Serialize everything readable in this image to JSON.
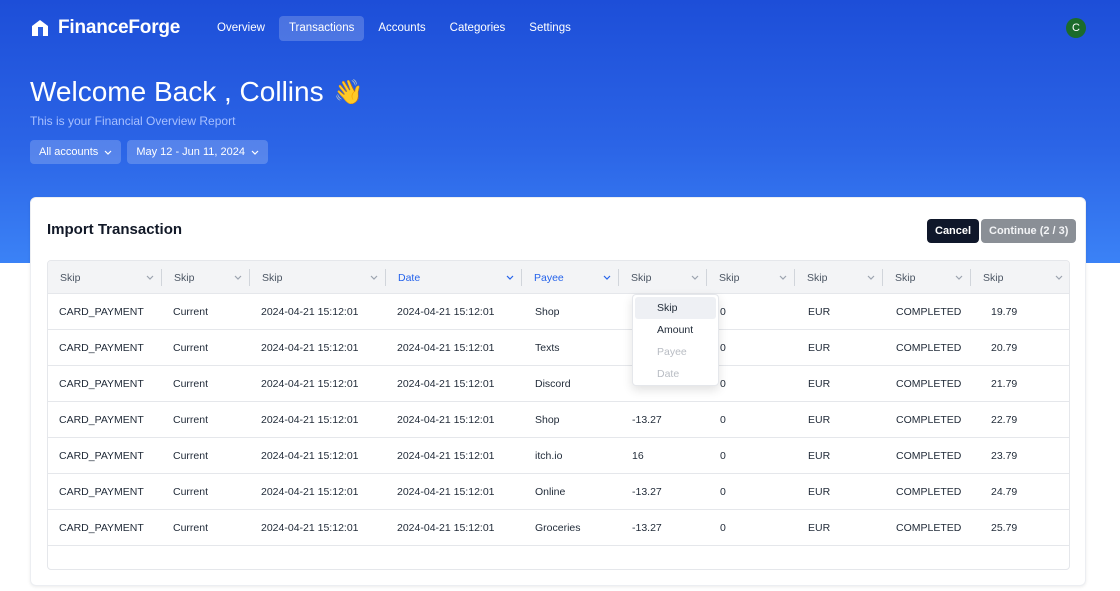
{
  "app": {
    "name": "FinanceForge"
  },
  "nav": {
    "links": [
      {
        "label": "Overview"
      },
      {
        "label": "Transactions"
      },
      {
        "label": "Accounts"
      },
      {
        "label": "Categories"
      },
      {
        "label": "Settings"
      }
    ],
    "active": "Transactions",
    "avatar_initial": "C"
  },
  "hero": {
    "welcome": "Welcome Back , Collins",
    "wave": "👋",
    "subtitle": "This is your Financial Overview Report",
    "account_filter": "All accounts",
    "date_filter": "May 12 - Jun 11, 2024"
  },
  "import": {
    "title": "Import Transaction",
    "cancel_label": "Cancel",
    "continue_label": "Continue (2 / 3)",
    "headers": [
      "Skip",
      "Skip",
      "Skip",
      "Date",
      "Payee",
      "Skip",
      "Skip",
      "Skip",
      "Skip",
      "Skip"
    ],
    "rows": [
      [
        "CARD_PAYMENT",
        "Current",
        "2024-04-21 15:12:01",
        "2024-04-21 15:12:01",
        "Shop",
        "",
        "0",
        "EUR",
        "COMPLETED",
        "19.79"
      ],
      [
        "CARD_PAYMENT",
        "Current",
        "2024-04-21 15:12:01",
        "2024-04-21 15:12:01",
        "Texts",
        "",
        "0",
        "EUR",
        "COMPLETED",
        "20.79"
      ],
      [
        "CARD_PAYMENT",
        "Current",
        "2024-04-21 15:12:01",
        "2024-04-21 15:12:01",
        "Discord",
        "",
        "0",
        "EUR",
        "COMPLETED",
        "21.79"
      ],
      [
        "CARD_PAYMENT",
        "Current",
        "2024-04-21 15:12:01",
        "2024-04-21 15:12:01",
        "Shop",
        "-13.27",
        "0",
        "EUR",
        "COMPLETED",
        "22.79"
      ],
      [
        "CARD_PAYMENT",
        "Current",
        "2024-04-21 15:12:01",
        "2024-04-21 15:12:01",
        "itch.io",
        "16",
        "0",
        "EUR",
        "COMPLETED",
        "23.79"
      ],
      [
        "CARD_PAYMENT",
        "Current",
        "2024-04-21 15:12:01",
        "2024-04-21 15:12:01",
        "Online",
        "-13.27",
        "0",
        "EUR",
        "COMPLETED",
        "24.79"
      ],
      [
        "CARD_PAYMENT",
        "Current",
        "2024-04-21 15:12:01",
        "2024-04-21 15:12:01",
        "Groceries",
        "-13.27",
        "0",
        "EUR",
        "COMPLETED",
        "25.79"
      ]
    ],
    "dropdown_options": [
      {
        "label": "Skip",
        "state": "selected"
      },
      {
        "label": "Amount",
        "state": "enabled"
      },
      {
        "label": "Payee",
        "state": "disabled"
      },
      {
        "label": "Date",
        "state": "disabled"
      }
    ]
  },
  "colors": {
    "hero_gradient_top": "#1d4ed8",
    "hero_gradient_bottom": "#3b82f6",
    "accent": "#2563eb",
    "cancel_bg": "#0f172a",
    "continue_bg": "#8a8f96",
    "avatar_bg": "#1b6b2b"
  }
}
